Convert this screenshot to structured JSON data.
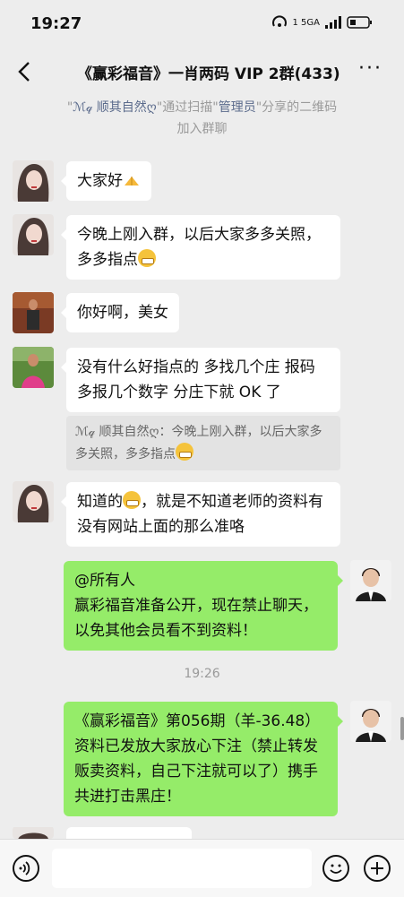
{
  "status": {
    "time": "19:27",
    "signal": "1 5GA"
  },
  "header": {
    "title": "《赢彩福音》一肖两码 VIP 2群(433)",
    "more": "···"
  },
  "system_join": {
    "line1_prefix": "\"",
    "user": "ℳ𝓆 顺其自然ღ",
    "mid": "\"通过扫描\"",
    "admin": "管理员",
    "suffix": "\"分享的二维码",
    "line2": "加入群聊"
  },
  "messages": [
    {
      "text": "大家好"
    },
    {
      "text": "今晚上刚入群，以后大家多多关照，多多指点"
    },
    {
      "text": "你好啊，美女"
    },
    {
      "text": "没有什么好指点的 多找几个庄 报码多报几个数字 分庄下就 OK 了"
    },
    {
      "quote": "ℳ𝓆 顺其自然ღ：今晚上刚入群，以后大家多多关照，多多指点"
    },
    {
      "text_a": "知道的",
      "text_b": "，就是不知道老师的资料有没有网站上面的那么准咯"
    },
    {
      "text": "@所有人\n赢彩福音准备公开，现在禁止聊天，以免其他会员看不到资料！"
    },
    {
      "text": "《赢彩福音》第056期（羊-36.48）资料已发放大家放心下注（禁止转发贩卖资料，自己下注就可以了）携手共进打击黑庄！"
    }
  ],
  "timestamp": "19:26",
  "colors": {
    "bubble_right": "#95ec69",
    "bubble_left": "#ffffff",
    "background": "#ededed"
  }
}
